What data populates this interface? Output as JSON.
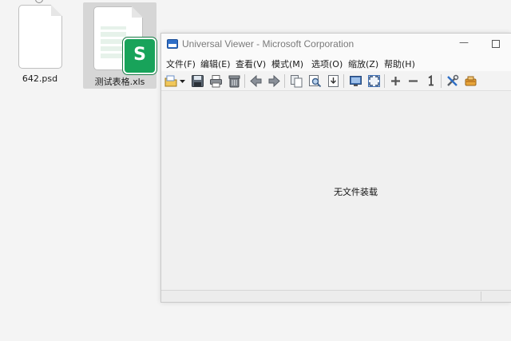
{
  "desktop": {
    "files": [
      {
        "name": "642.psd"
      },
      {
        "name": "测试表格.xls",
        "badge": "S"
      }
    ]
  },
  "window": {
    "title": "Universal Viewer - Microsoft Corporation",
    "controls": {
      "minimize": "—"
    },
    "menu": [
      "文件(F)",
      "编辑(E)",
      "查看(V)",
      "模式(M)",
      "选项(O)",
      "缩放(Z)",
      "帮助(H)"
    ],
    "toolbar_icons": [
      "open-folder-icon",
      "dropdown-arrow-icon",
      "save-icon",
      "print-icon",
      "recycle-bin-icon",
      "back-arrow-icon",
      "forward-arrow-icon",
      "copy-icon",
      "find-icon",
      "export-icon",
      "screen-icon",
      "fullscreen-icon",
      "zoom-in-icon",
      "zoom-out-icon",
      "original-size-icon",
      "settings-tools-icon",
      "plugin-icon"
    ],
    "content": {
      "empty_message": "无文件装载"
    },
    "accent_color": "#18a35a"
  }
}
